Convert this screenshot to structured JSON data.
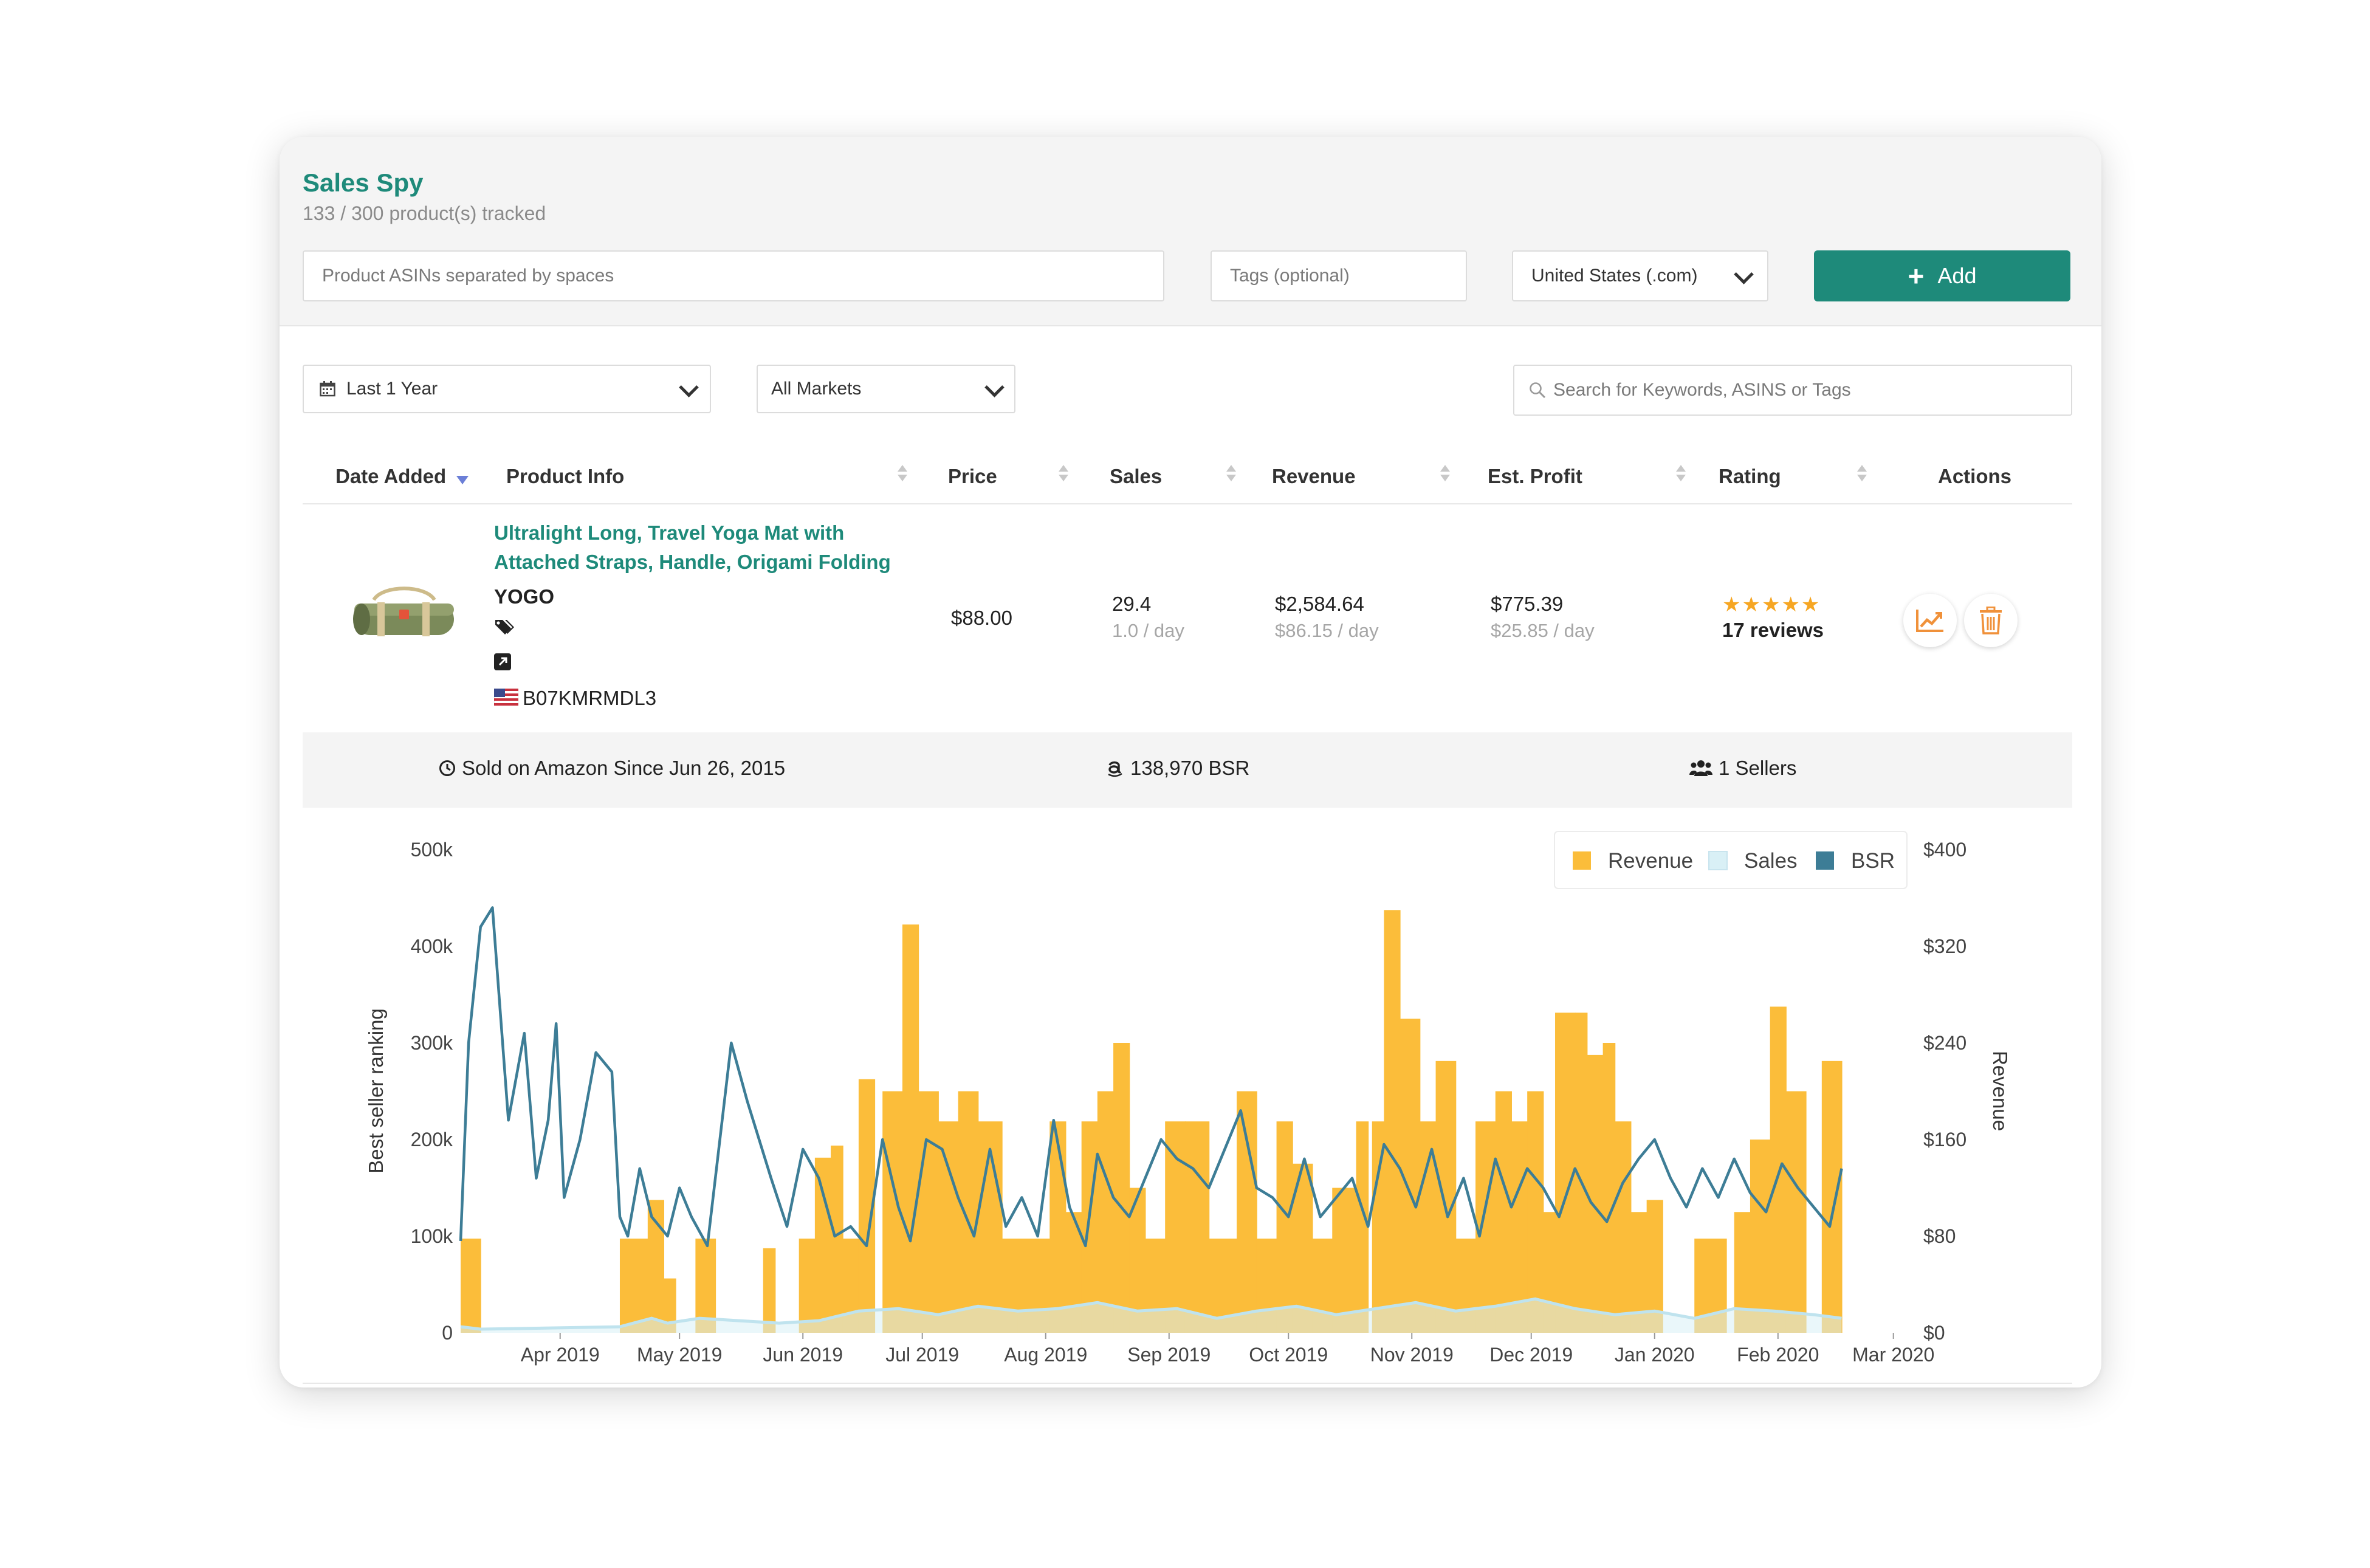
{
  "app": {
    "title": "Sales Spy",
    "tracked": "133 / 300 product(s) tracked"
  },
  "toolbar": {
    "asin_placeholder": "Product ASINs separated by spaces",
    "tags_placeholder": "Tags (optional)",
    "market_value": "United States (.com)",
    "add_label": "Add"
  },
  "filters": {
    "range_value": "Last 1 Year",
    "markets_value": "All Markets",
    "search_placeholder": "Search for Keywords, ASINS or Tags"
  },
  "table": {
    "columns": [
      "Date Added",
      "Product Info",
      "Price",
      "Sales",
      "Revenue",
      "Est. Profit",
      "Rating",
      "Actions"
    ]
  },
  "product": {
    "title": "Ultralight Long, Travel Yoga Mat with Attached Straps, Handle, Origami Folding",
    "brand": "YOGO",
    "asin": "B07KMRMDL3",
    "price": "$88.00",
    "sales": "29.4",
    "sales_per_day": "1.0 / day",
    "revenue": "$2,584.64",
    "revenue_per_day": "$86.15 / day",
    "profit": "$775.39",
    "profit_per_day": "$25.85 / day",
    "stars": "★★★★★",
    "reviews": "17 reviews"
  },
  "info": {
    "since": "Sold on Amazon Since Jun 26, 2015",
    "bsr": "138,970 BSR",
    "sellers": "1 Sellers"
  },
  "colors": {
    "accent": "#1e8a7a",
    "revenue": "#fbbd3a",
    "sales": "#d9f0f6",
    "bsr": "#3d7d96",
    "action": "#f0913a"
  },
  "icons": [
    "calendar-icon",
    "search-icon",
    "tag-icon",
    "external-link-icon",
    "us-flag-icon",
    "clock-icon",
    "amazon-icon",
    "users-icon",
    "chart-icon",
    "trash-icon"
  ],
  "chart_data": {
    "type": "bar",
    "legend": [
      "Revenue",
      "Sales",
      "BSR"
    ],
    "legend_position": "top-right",
    "ylabel_left": "Best seller ranking",
    "ylabel_right": "Revenue",
    "yticks_left": [
      "0",
      "100k",
      "200k",
      "300k",
      "400k",
      "500k"
    ],
    "yticks_right": [
      "$0",
      "$80",
      "$160",
      "$240",
      "$320",
      "$400"
    ],
    "ylim_left": [
      0,
      500000
    ],
    "ylim_right": [
      0,
      400
    ],
    "xticks": [
      "Apr 2019",
      "May 2019",
      "Jun 2019",
      "Jul 2019",
      "Aug 2019",
      "Sep 2019",
      "Oct 2019",
      "Nov 2019",
      "Dec 2019",
      "Jan 2020",
      "Feb 2020",
      "Mar 2020"
    ],
    "x_range_days": [
      0,
      366
    ],
    "revenue_bars": [
      [
        0,
        5,
        78
      ],
      [
        40,
        47,
        78
      ],
      [
        47,
        51,
        110
      ],
      [
        51,
        54,
        45
      ],
      [
        59,
        64,
        78
      ],
      [
        76,
        79,
        70
      ],
      [
        85,
        89,
        78
      ],
      [
        89,
        93,
        145
      ],
      [
        93,
        96,
        155
      ],
      [
        96,
        100,
        78
      ],
      [
        100,
        104,
        210
      ],
      [
        106,
        111,
        200
      ],
      [
        111,
        115,
        338
      ],
      [
        115,
        120,
        200
      ],
      [
        120,
        125,
        175
      ],
      [
        125,
        130,
        200
      ],
      [
        130,
        136,
        175
      ],
      [
        135,
        140,
        78
      ],
      [
        140,
        148,
        78
      ],
      [
        148,
        152,
        175
      ],
      [
        152,
        156,
        100
      ],
      [
        156,
        160,
        175
      ],
      [
        160,
        164,
        200
      ],
      [
        164,
        168,
        240
      ],
      [
        168,
        172,
        120
      ],
      [
        172,
        177,
        78
      ],
      [
        177,
        182,
        175
      ],
      [
        182,
        188,
        175
      ],
      [
        188,
        195,
        78
      ],
      [
        195,
        200,
        200
      ],
      [
        200,
        205,
        78
      ],
      [
        205,
        209,
        175
      ],
      [
        209,
        214,
        140
      ],
      [
        214,
        219,
        78
      ],
      [
        219,
        225,
        120
      ],
      [
        225,
        228,
        175
      ],
      [
        229,
        232,
        175
      ],
      [
        232,
        236,
        350
      ],
      [
        236,
        241,
        260
      ],
      [
        241,
        245,
        175
      ],
      [
        245,
        250,
        225
      ],
      [
        250,
        255,
        78
      ],
      [
        255,
        260,
        175
      ],
      [
        260,
        264,
        200
      ],
      [
        264,
        268,
        175
      ],
      [
        268,
        272,
        200
      ],
      [
        272,
        275,
        100
      ],
      [
        275,
        280,
        265
      ],
      [
        280,
        283,
        265
      ],
      [
        283,
        287,
        230
      ],
      [
        287,
        290,
        240
      ],
      [
        290,
        294,
        175
      ],
      [
        294,
        298,
        100
      ],
      [
        298,
        302,
        110
      ],
      [
        310,
        318,
        78
      ],
      [
        320,
        324,
        100
      ],
      [
        324,
        329,
        160
      ],
      [
        329,
        333,
        270
      ],
      [
        333,
        338,
        200
      ],
      [
        342,
        347,
        225
      ]
    ],
    "bsr_points": [
      [
        0,
        95000
      ],
      [
        2,
        300000
      ],
      [
        5,
        420000
      ],
      [
        8,
        440000
      ],
      [
        12,
        220000
      ],
      [
        16,
        310000
      ],
      [
        19,
        160000
      ],
      [
        22,
        220000
      ],
      [
        24,
        320000
      ],
      [
        26,
        140000
      ],
      [
        30,
        200000
      ],
      [
        34,
        290000
      ],
      [
        38,
        270000
      ],
      [
        40,
        120000
      ],
      [
        42,
        100000
      ],
      [
        45,
        170000
      ],
      [
        48,
        120000
      ],
      [
        52,
        100000
      ],
      [
        55,
        150000
      ],
      [
        58,
        120000
      ],
      [
        62,
        90000
      ],
      [
        68,
        300000
      ],
      [
        72,
        240000
      ],
      [
        78,
        160000
      ],
      [
        82,
        110000
      ],
      [
        86,
        190000
      ],
      [
        90,
        160000
      ],
      [
        94,
        100000
      ],
      [
        98,
        110000
      ],
      [
        102,
        90000
      ],
      [
        106,
        200000
      ],
      [
        110,
        130000
      ],
      [
        113,
        95000
      ],
      [
        117,
        200000
      ],
      [
        121,
        190000
      ],
      [
        125,
        140000
      ],
      [
        129,
        100000
      ],
      [
        133,
        190000
      ],
      [
        137,
        110000
      ],
      [
        141,
        140000
      ],
      [
        145,
        100000
      ],
      [
        149,
        220000
      ],
      [
        153,
        130000
      ],
      [
        157,
        90000
      ],
      [
        160,
        185000
      ],
      [
        164,
        140000
      ],
      [
        168,
        120000
      ],
      [
        172,
        160000
      ],
      [
        176,
        200000
      ],
      [
        180,
        180000
      ],
      [
        184,
        170000
      ],
      [
        188,
        150000
      ],
      [
        192,
        190000
      ],
      [
        196,
        230000
      ],
      [
        200,
        150000
      ],
      [
        204,
        140000
      ],
      [
        208,
        120000
      ],
      [
        212,
        180000
      ],
      [
        216,
        120000
      ],
      [
        220,
        140000
      ],
      [
        224,
        160000
      ],
      [
        228,
        110000
      ],
      [
        232,
        195000
      ],
      [
        236,
        170000
      ],
      [
        240,
        130000
      ],
      [
        244,
        190000
      ],
      [
        248,
        120000
      ],
      [
        252,
        160000
      ],
      [
        256,
        100000
      ],
      [
        260,
        180000
      ],
      [
        264,
        130000
      ],
      [
        268,
        170000
      ],
      [
        272,
        150000
      ],
      [
        276,
        120000
      ],
      [
        280,
        170000
      ],
      [
        284,
        135000
      ],
      [
        288,
        115000
      ],
      [
        292,
        155000
      ],
      [
        296,
        180000
      ],
      [
        300,
        200000
      ],
      [
        304,
        160000
      ],
      [
        308,
        130000
      ],
      [
        312,
        170000
      ],
      [
        316,
        140000
      ],
      [
        320,
        180000
      ],
      [
        324,
        145000
      ],
      [
        328,
        125000
      ],
      [
        332,
        175000
      ],
      [
        336,
        150000
      ],
      [
        340,
        130000
      ],
      [
        344,
        110000
      ],
      [
        347,
        170000
      ]
    ],
    "sales_points": [
      [
        0,
        5
      ],
      [
        5,
        3
      ],
      [
        40,
        5
      ],
      [
        48,
        12
      ],
      [
        52,
        8
      ],
      [
        60,
        12
      ],
      [
        80,
        8
      ],
      [
        90,
        10
      ],
      [
        100,
        18
      ],
      [
        110,
        20
      ],
      [
        120,
        15
      ],
      [
        130,
        22
      ],
      [
        140,
        18
      ],
      [
        150,
        20
      ],
      [
        160,
        25
      ],
      [
        170,
        18
      ],
      [
        180,
        20
      ],
      [
        190,
        12
      ],
      [
        200,
        18
      ],
      [
        210,
        22
      ],
      [
        220,
        15
      ],
      [
        230,
        20
      ],
      [
        240,
        25
      ],
      [
        250,
        18
      ],
      [
        260,
        22
      ],
      [
        270,
        28
      ],
      [
        280,
        20
      ],
      [
        290,
        15
      ],
      [
        300,
        18
      ],
      [
        310,
        12
      ],
      [
        320,
        20
      ],
      [
        330,
        18
      ],
      [
        340,
        15
      ],
      [
        347,
        12
      ]
    ]
  }
}
